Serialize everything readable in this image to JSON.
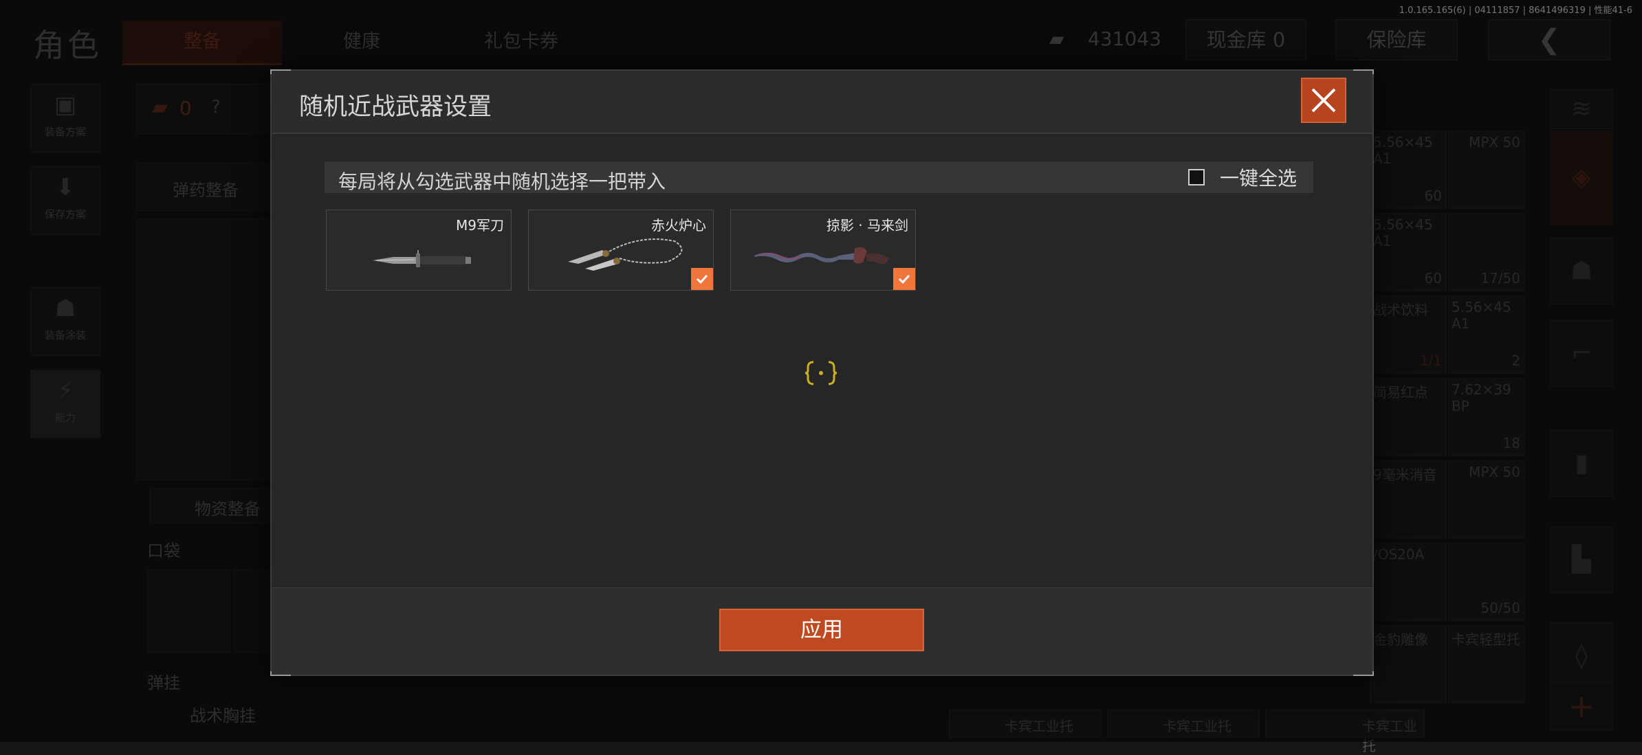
{
  "version": "1.0.165.165(6) | 04111857 | 8641496319 | 性能41-6",
  "background": {
    "title": "角色",
    "tabs": [
      "整备",
      "健康",
      "礼包卡券"
    ],
    "currency_value": "431043",
    "cash_button": "现金库 0",
    "insurance_button": "保险库",
    "left_menu": [
      "装备方案",
      "保存方案",
      "装备涂装",
      "能力"
    ],
    "armor_count": "0",
    "ammo_section": "弹药整备",
    "supply_section": "物资整备",
    "pocket_label": "口袋",
    "rig_label": "弹挂",
    "rig_item": "战术胸挂",
    "right_items": [
      {
        "name": "5.56×45 A1",
        "count": "60"
      },
      {
        "name": "MPX 50",
        "count": ""
      },
      {
        "name": "5.56×45 A1",
        "count": "60"
      },
      {
        "name": "",
        "count": "17/50"
      },
      {
        "name": "战术饮料",
        "count": "1/1"
      },
      {
        "name": "5.56×45 A1",
        "count": "2"
      },
      {
        "name": "简易红点",
        "count": ""
      },
      {
        "name": "7.62×39 BP",
        "count": "18"
      },
      {
        "name": "9毫米消音",
        "count": ""
      },
      {
        "name": "MPX 50",
        "count": ""
      },
      {
        "name": "/OS20A",
        "count": ""
      },
      {
        "name": "",
        "count": "50/50"
      },
      {
        "name": "金豹雕像",
        "count": ""
      },
      {
        "name": "卡宾轻型托",
        "count": ""
      }
    ],
    "bottom_items": [
      "卡宾工业托",
      "卡宾工业托",
      "卡宾工业托"
    ]
  },
  "dialog": {
    "title": "随机近战武器设置",
    "info": "每局将从勾选武器中随机选择一把带入",
    "select_all": "一键全选",
    "select_all_checked": false,
    "weapons": [
      {
        "name": "M9军刀",
        "checked": false
      },
      {
        "name": "赤火炉心",
        "checked": true
      },
      {
        "name": "掠影 · 马来剑",
        "checked": true
      }
    ],
    "apply_label": "应用"
  },
  "colors": {
    "accent": "#f0763c",
    "button": "#bf4a22"
  }
}
